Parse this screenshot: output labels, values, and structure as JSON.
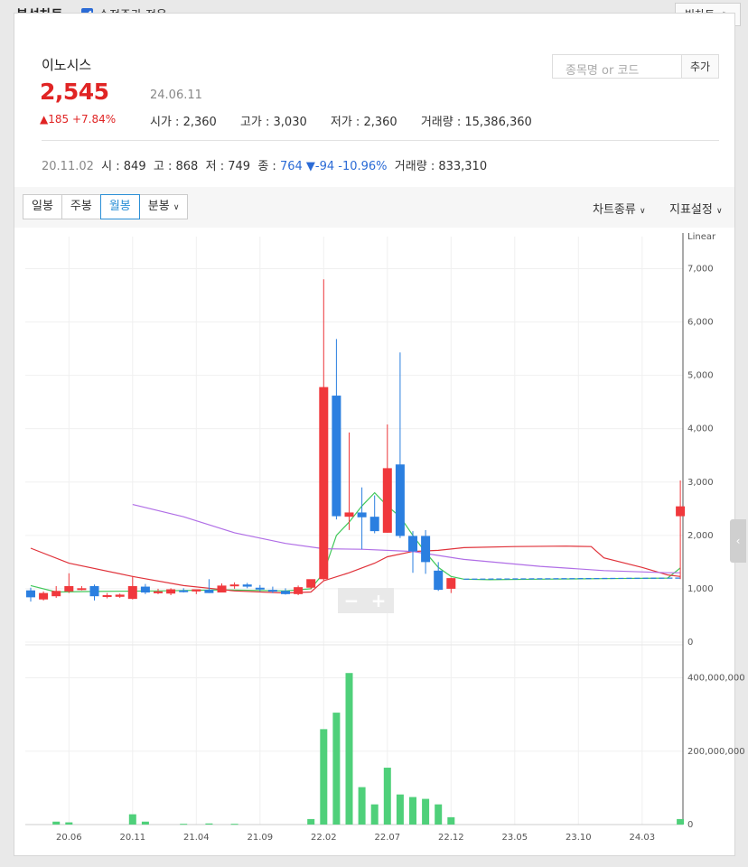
{
  "header": {
    "title": "분석차트",
    "adjusted_label": "수정주가 적용",
    "big_chart_label": "빅차트",
    "big_chart_arrow": ">"
  },
  "stock": {
    "name": "이노시스",
    "price": "2,545",
    "date": "24.06.11",
    "change": "▲185 +7.84%",
    "open_label": "시가",
    "open": "2,360",
    "high_label": "고가",
    "high": "3,030",
    "low_label": "저가",
    "low": "2,360",
    "volume_label": "거래량",
    "volume": "15,386,360"
  },
  "search": {
    "placeholder": "종목명 or 코드",
    "add_label": "추가"
  },
  "hover": {
    "date": "20.11.02",
    "open_label": "시",
    "open": "849",
    "high_label": "고",
    "high": "868",
    "low_label": "저",
    "low": "749",
    "close_label": "종",
    "close": "764",
    "change": "▼-94 -10.96%",
    "volume_label": "거래량",
    "volume": "833,310"
  },
  "toolbar": {
    "periods": [
      "일봉",
      "주봉",
      "월봉",
      "분봉"
    ],
    "active": "월봉",
    "chart_type_label": "차트종류",
    "indicator_label": "지표설정"
  },
  "zoom": {
    "minus": "−",
    "plus": "+"
  },
  "colors": {
    "up": "#f0383c",
    "down": "#2b7fe0",
    "volume": "#4fd07a",
    "ma_green": "#41c85a",
    "ma_red": "#e0323a",
    "ma_purple": "#b06ee6"
  },
  "chart_data": {
    "type": "candlestick",
    "scale_label": "Linear",
    "price_axis": {
      "ticks": [
        0,
        1000,
        2000,
        3000,
        4000,
        5000,
        6000,
        7000
      ],
      "labels": [
        "0",
        "1,000",
        "2,000",
        "3,000",
        "4,000",
        "5,000",
        "6,000",
        "7,000"
      ],
      "ylim": [
        0,
        7600
      ]
    },
    "volume_axis": {
      "ticks": [
        0,
        200000000,
        400000000
      ],
      "labels": [
        "0",
        "200,000,000",
        "400,000,000"
      ],
      "ylim": [
        0,
        480000000
      ]
    },
    "x_tick_labels": [
      "20.06",
      "20.11",
      "21.04",
      "21.09",
      "22.02",
      "22.07",
      "22.12",
      "23.05",
      "23.10",
      "24.03"
    ],
    "x_tick_index": [
      3,
      8,
      13,
      18,
      23,
      28,
      33,
      38,
      43,
      48
    ],
    "candles": [
      {
        "o": 970,
        "h": 1020,
        "l": 760,
        "c": 840
      },
      {
        "o": 800,
        "h": 950,
        "l": 780,
        "c": 920
      },
      {
        "o": 860,
        "h": 1050,
        "l": 830,
        "c": 960
      },
      {
        "o": 950,
        "h": 1290,
        "l": 920,
        "c": 1050
      },
      {
        "o": 1000,
        "h": 1050,
        "l": 970,
        "c": 1010
      },
      {
        "o": 1050,
        "h": 1080,
        "l": 780,
        "c": 860
      },
      {
        "o": 860,
        "h": 920,
        "l": 820,
        "c": 880
      },
      {
        "o": 850,
        "h": 910,
        "l": 830,
        "c": 890
      },
      {
        "o": 810,
        "h": 1240,
        "l": 800,
        "c": 1050
      },
      {
        "o": 1040,
        "h": 1090,
        "l": 900,
        "c": 930
      },
      {
        "o": 930,
        "h": 1000,
        "l": 900,
        "c": 950
      },
      {
        "o": 910,
        "h": 1010,
        "l": 880,
        "c": 990
      },
      {
        "o": 970,
        "h": 1010,
        "l": 930,
        "c": 960
      },
      {
        "o": 950,
        "h": 990,
        "l": 900,
        "c": 990
      },
      {
        "o": 980,
        "h": 1180,
        "l": 920,
        "c": 920
      },
      {
        "o": 930,
        "h": 1100,
        "l": 930,
        "c": 1060
      },
      {
        "o": 1050,
        "h": 1120,
        "l": 1000,
        "c": 1080
      },
      {
        "o": 1080,
        "h": 1110,
        "l": 1010,
        "c": 1040
      },
      {
        "o": 1020,
        "h": 1070,
        "l": 950,
        "c": 990
      },
      {
        "o": 980,
        "h": 1040,
        "l": 920,
        "c": 960
      },
      {
        "o": 960,
        "h": 1010,
        "l": 890,
        "c": 900
      },
      {
        "o": 900,
        "h": 1060,
        "l": 880,
        "c": 1030
      },
      {
        "o": 1020,
        "h": 1150,
        "l": 990,
        "c": 1180
      },
      {
        "o": 1180,
        "h": 6800,
        "l": 1150,
        "c": 4780
      },
      {
        "o": 4620,
        "h": 5680,
        "l": 2300,
        "c": 2360
      },
      {
        "o": 2350,
        "h": 3930,
        "l": 2100,
        "c": 2430
      },
      {
        "o": 2430,
        "h": 2900,
        "l": 1740,
        "c": 2340
      },
      {
        "o": 2350,
        "h": 2750,
        "l": 2040,
        "c": 2080
      },
      {
        "o": 2050,
        "h": 4080,
        "l": 2050,
        "c": 3260
      },
      {
        "o": 3330,
        "h": 5430,
        "l": 1950,
        "c": 1990
      },
      {
        "o": 1990,
        "h": 2080,
        "l": 1300,
        "c": 1700
      },
      {
        "o": 1990,
        "h": 2100,
        "l": 1280,
        "c": 1500
      },
      {
        "o": 1340,
        "h": 1500,
        "l": 960,
        "c": 980
      },
      {
        "o": 1000,
        "h": 1210,
        "l": 920,
        "c": 1200
      },
      {
        "o": 2360,
        "h": 3030,
        "l": 1180,
        "c": 2545
      }
    ],
    "candle_index": [
      0,
      1,
      2,
      3,
      4,
      5,
      6,
      7,
      8,
      9,
      10,
      11,
      12,
      13,
      14,
      15,
      16,
      17,
      18,
      19,
      20,
      21,
      22,
      23,
      24,
      25,
      26,
      27,
      28,
      29,
      30,
      31,
      32,
      33,
      51
    ],
    "volume": [
      {
        "i": 2,
        "v": 8000000
      },
      {
        "i": 3,
        "v": 6000000
      },
      {
        "i": 8,
        "v": 28000000
      },
      {
        "i": 9,
        "v": 8000000
      },
      {
        "i": 12,
        "v": 2000000
      },
      {
        "i": 14,
        "v": 3000000
      },
      {
        "i": 16,
        "v": 2000000
      },
      {
        "i": 22,
        "v": 15000000
      },
      {
        "i": 23,
        "v": 260000000
      },
      {
        "i": 24,
        "v": 305000000
      },
      {
        "i": 25,
        "v": 413000000
      },
      {
        "i": 26,
        "v": 102000000
      },
      {
        "i": 27,
        "v": 55000000
      },
      {
        "i": 28,
        "v": 155000000
      },
      {
        "i": 29,
        "v": 82000000
      },
      {
        "i": 30,
        "v": 75000000
      },
      {
        "i": 31,
        "v": 70000000
      },
      {
        "i": 32,
        "v": 55000000
      },
      {
        "i": 33,
        "v": 20000000
      },
      {
        "i": 51,
        "v": 15000000
      }
    ],
    "series": [
      {
        "color": "green",
        "points": [
          [
            0,
            1060
          ],
          [
            2,
            940
          ],
          [
            5,
            950
          ],
          [
            10,
            960
          ],
          [
            15,
            980
          ],
          [
            20,
            960
          ],
          [
            22,
            1000
          ],
          [
            23,
            1300
          ],
          [
            24,
            2000
          ],
          [
            25,
            2250
          ],
          [
            26,
            2550
          ],
          [
            27,
            2800
          ],
          [
            28,
            2550
          ],
          [
            29,
            2350
          ],
          [
            30,
            2000
          ],
          [
            31,
            1680
          ],
          [
            32,
            1400
          ],
          [
            33,
            1230
          ],
          [
            34,
            1180
          ],
          [
            36,
            1170
          ],
          [
            40,
            1180
          ],
          [
            45,
            1190
          ],
          [
            50,
            1200
          ],
          [
            51,
            1390
          ]
        ]
      },
      {
        "color": "red",
        "points": [
          [
            0,
            1760
          ],
          [
            3,
            1480
          ],
          [
            8,
            1230
          ],
          [
            12,
            1060
          ],
          [
            16,
            960
          ],
          [
            20,
            920
          ],
          [
            22,
            940
          ],
          [
            23,
            1150
          ],
          [
            25,
            1300
          ],
          [
            27,
            1480
          ],
          [
            28,
            1600
          ],
          [
            30,
            1700
          ],
          [
            32,
            1720
          ],
          [
            34,
            1770
          ],
          [
            38,
            1790
          ],
          [
            42,
            1800
          ],
          [
            44,
            1790
          ],
          [
            45,
            1580
          ],
          [
            48,
            1400
          ],
          [
            50,
            1260
          ],
          [
            51,
            1230
          ]
        ]
      },
      {
        "color": "purple",
        "points": [
          [
            8,
            2580
          ],
          [
            12,
            2350
          ],
          [
            16,
            2050
          ],
          [
            20,
            1850
          ],
          [
            23,
            1750
          ],
          [
            26,
            1740
          ],
          [
            30,
            1700
          ],
          [
            34,
            1550
          ],
          [
            40,
            1420
          ],
          [
            45,
            1340
          ],
          [
            50,
            1300
          ],
          [
            51,
            1300
          ]
        ]
      },
      {
        "color": "dashed",
        "points": [
          [
            34,
            1180
          ],
          [
            51,
            1200
          ]
        ]
      }
    ]
  }
}
